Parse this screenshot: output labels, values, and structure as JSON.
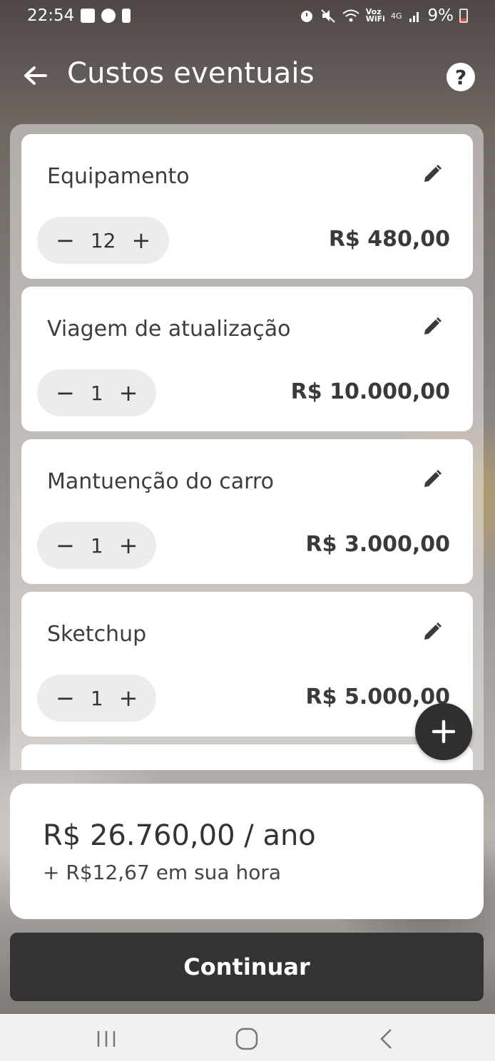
{
  "status_bar": {
    "time": "22:54",
    "voz_top": "Voz",
    "voz_bottom": "WiFi",
    "network": "4G",
    "battery": "9%"
  },
  "header": {
    "title": "Custos eventuais"
  },
  "items": [
    {
      "name": "Equipamento",
      "quantity": "12",
      "price": "R$ 480,00"
    },
    {
      "name": "Viagem de atualização",
      "quantity": "1",
      "price": "R$ 10.000,00"
    },
    {
      "name": "Mantuenção do carro",
      "quantity": "1",
      "price": "R$ 3.000,00"
    },
    {
      "name": "Sketchup",
      "quantity": "1",
      "price": "R$ 5.000,00"
    }
  ],
  "summary": {
    "total": "R$ 26.760,00 / ano",
    "per_hour": "+ R$12,67 em sua hora"
  },
  "actions": {
    "continue_label": "Continuar"
  },
  "colors": {
    "dark": "#333333",
    "card": "#ffffff",
    "stepper_bg": "#ececec"
  }
}
